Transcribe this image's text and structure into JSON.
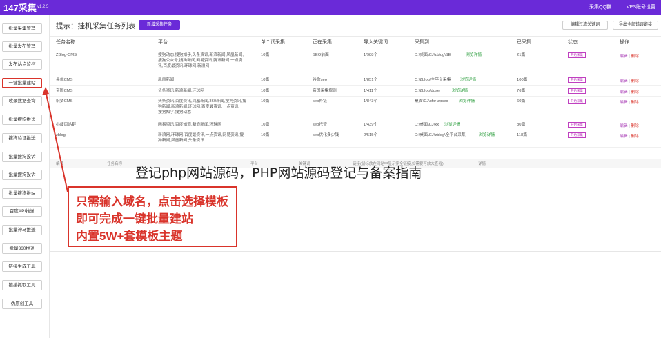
{
  "app": {
    "logo": "147采集",
    "version": "v1.2.5",
    "nav_qq": "采集QQ群",
    "nav_vps": "VPS账号设置"
  },
  "sidebar": {
    "items": [
      {
        "label": "批量采集管理"
      },
      {
        "label": "批量发布管理"
      },
      {
        "label": "发布站点监控"
      },
      {
        "label": "一键批量建站"
      },
      {
        "label": "收录数据查询"
      },
      {
        "label": "批量搜狗推送"
      },
      {
        "label": "搜狗验证推送"
      },
      {
        "label": "批量搜狗投诉"
      },
      {
        "label": "批量搜狗投诉"
      },
      {
        "label": "批量搜狗推站"
      },
      {
        "label": "百度API推送"
      },
      {
        "label": "批量神马推送"
      },
      {
        "label": "批量360推送"
      },
      {
        "label": "链接生成工具"
      },
      {
        "label": "链接抓取工具"
      },
      {
        "label": "伪原创工具"
      }
    ],
    "active_index": 3
  },
  "main": {
    "tip": "提示：挂机采集任务列表",
    "new_task_button": "新增采集任务",
    "clear_button": "编辑过滤关键词",
    "export_button": "导出全部错误链接"
  },
  "table": {
    "headers": [
      "任务名称",
      "平台",
      "单个词采集",
      "正在采集",
      "导入关键词",
      "采集到",
      "已采集",
      "状态",
      "操作"
    ],
    "rows": [
      {
        "name": "ZBlog-CMS",
        "platform": [
          "搜狗动态,搜狗知乎,头条资讯,新浪新闻,凤凰新闻,",
          "搜狗公众号,搜狗新闻,网易资讯,腾讯新闻,一点资",
          "讯,百度最资讯,环球网,新浪网"
        ],
        "single": "10篇",
        "collecting": "SEO前面",
        "keywords": "1/988个",
        "path": "D:\\桌面\\CJ\\zblog\\SE",
        "path_link": "浏览详情",
        "collected": "21篇",
        "status": "开始采集",
        "edit": "编辑",
        "delete": "删除"
      },
      {
        "name": "易优CMS",
        "platform": [
          "凤凰新闻"
        ],
        "single": "10篇",
        "collecting": "谷歌seo",
        "keywords": "1/851个",
        "path": "C:\\Zblog\\全平台采集",
        "path_link": "浏览详情",
        "collected": "100篇",
        "status": "开始采集",
        "edit": "编辑",
        "delete": "删除"
      },
      {
        "name": "帝国CMS",
        "platform": [
          "头条资讯,新浪新闻,环球网"
        ],
        "single": "10篇",
        "collecting": "帝国采集规则",
        "keywords": "1/411个",
        "path": "C:\\Zblog\\dgse",
        "path_link": "浏览详情",
        "collected": "76篇",
        "status": "开始采集",
        "edit": "编辑",
        "delete": "删除"
      },
      {
        "name": "织梦CMS",
        "platform": [
          "头条资讯,百度资讯,凤凰新闻,360新闻,搜狗资讯,搜",
          "狗新闻,新浪新闻,环球网,百度最资讯,一点资讯,",
          "搜狗知乎,搜狗动态"
        ],
        "single": "10篇",
        "collecting": "seo外链",
        "keywords": "1/843个",
        "path": "桌面\\CJ\\xfxr-zpseo",
        "path_link": "浏览详情",
        "collected": "60篇",
        "status": "开始采集",
        "edit": "编辑",
        "delete": "删除"
      },
      {
        "name": "小旋风站群",
        "platform": [
          "网易资讯,百度知道,新浪新闻,环球网"
        ],
        "single": "10篇",
        "collecting": "seo托管",
        "keywords": "1/439个",
        "path": "D:\\桌面\\CJ\\xx",
        "path_link": "浏览详情",
        "collected": "80篇",
        "status": "开始采集",
        "edit": "编辑",
        "delete": "删除"
      },
      {
        "name": "zblog",
        "platform": [
          "新浪网,环球网,百度最资讯,一点资讯,网易资讯,搜",
          "狗新闻,凤凰新闻,头条资讯"
        ],
        "single": "10篇",
        "collecting": "seo优化多少钱",
        "keywords": "2/515个",
        "path": "D:\\桌面\\CJ\\zblog\\全平台采集",
        "path_link": "浏览详情",
        "collected": "118篇",
        "status": "开始采集",
        "edit": "编辑",
        "delete": "删除"
      }
    ]
  },
  "table2": {
    "headers": [
      "编号",
      "任务名称",
      "平台",
      "关键词",
      "链接(鼠标放在网站中显示完全链接,如需要可放大查看)",
      "详情"
    ]
  },
  "overlay_title": "登记php网站源码，PHP网站源码登记与备案指南",
  "callout": {
    "lines": [
      "只需输入域名，点击选择模板",
      "即可完成一键批量建站",
      "内置5W+套模板主题"
    ],
    "color": "#d9342b"
  },
  "colors": {
    "accent": "#6a2ad8",
    "highlight": "#d9342b",
    "link": "#2a9d3c"
  }
}
